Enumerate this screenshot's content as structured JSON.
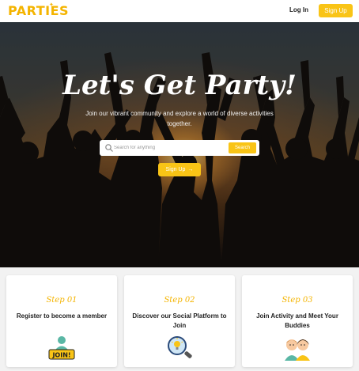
{
  "nav": {
    "logo": "PARTIES",
    "login": "Log In",
    "signup": "Sign Up"
  },
  "hero": {
    "title": "Let's Get Party!",
    "subtitle": "Join our vibrant community and explore a world of diverse activities together.",
    "search_placeholder": "Search for anything",
    "search_button": "Search",
    "signup_button": "Sign Up",
    "signup_arrow": "→"
  },
  "steps": [
    {
      "label": "Step 01",
      "title": "Register to become a member",
      "icon": "join-icon"
    },
    {
      "label": "Step 02",
      "title": "Discover our Social Platform to Join",
      "icon": "idea-search-icon"
    },
    {
      "label": "Step 03",
      "title": "Join Activity and Meet Your Buddies",
      "icon": "buddies-icon"
    }
  ],
  "colors": {
    "accent": "#f9c416",
    "brand": "#f4b400"
  }
}
